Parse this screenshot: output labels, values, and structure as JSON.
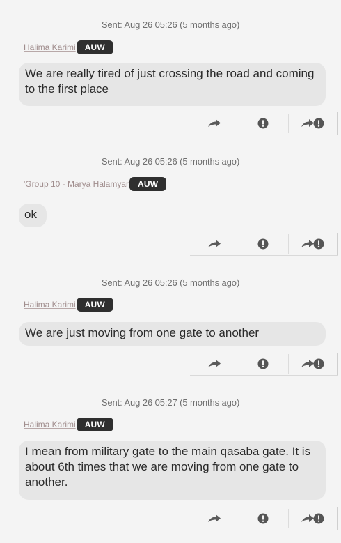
{
  "messages": [
    {
      "sent": "Sent: Aug 26 05:26 (5 months ago)",
      "sender": "Halima Karimi",
      "badge": "AUW",
      "text": "We are really tired of just crossing the road and coming to the first place"
    },
    {
      "sent": "Sent: Aug 26 05:26 (5 months ago)",
      "sender": "'Group 10 - Marya Halamyar",
      "badge": "AUW",
      "text": "ok"
    },
    {
      "sent": "Sent: Aug 26 05:26 (5 months ago)",
      "sender": "Halima Karimi",
      "badge": "AUW",
      "text": "We are just moving from one gate to another"
    },
    {
      "sent": "Sent: Aug 26 05:27 (5 months ago)",
      "sender": "Halima Karimi",
      "badge": "AUW",
      "text": "I mean from military gate to the main qasaba gate. It is about 6th times that we are moving from one gate to another."
    }
  ],
  "icons": {
    "forward": "forward-icon",
    "flag": "exclamation-icon",
    "forward_flag": "forward-exclamation-icon"
  },
  "colors": {
    "background": "#f4f4f4",
    "bubble": "#e6e6e6",
    "badge": "#2f2f2f",
    "icon": "#5a5a5a",
    "meta_text": "#6f6f6f",
    "sender_link": "#a08d8d"
  }
}
